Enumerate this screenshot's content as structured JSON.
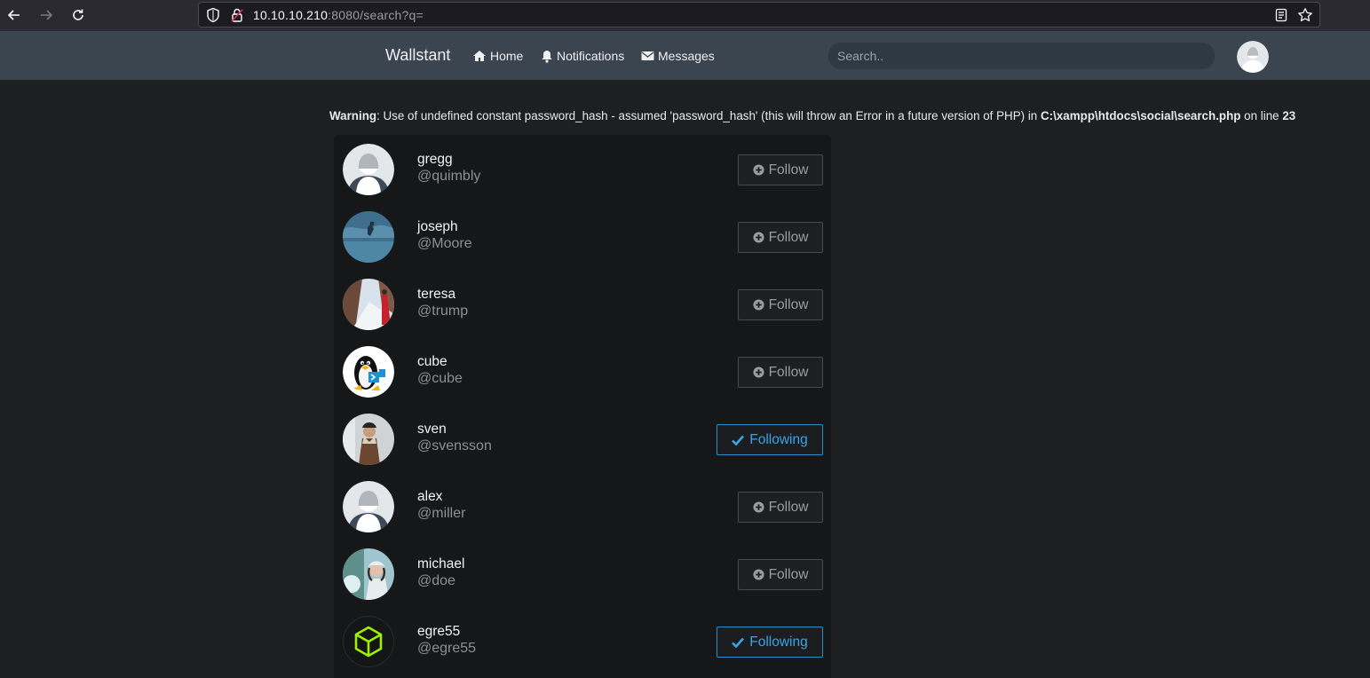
{
  "browser": {
    "url_host": "10.10.10.210",
    "url_rest": ":8080/search?q="
  },
  "navbar": {
    "brand": "Wallstant",
    "home": "Home",
    "notifications": "Notifications",
    "messages": "Messages",
    "search_placeholder": "Search.."
  },
  "warning": {
    "label": "Warning",
    "message": ": Use of undefined constant password_hash - assumed 'password_hash' (this will throw an Error in a future version of PHP) in ",
    "file": "C:\\xampp\\htdocs\\social\\search.php",
    "on_line": " on line ",
    "line": "23"
  },
  "colors": {
    "follow_text": "#9b9c9e",
    "following_accent": "#39a6e4",
    "navbar_bg": "#3a4550",
    "page_bg": "#1e1f21"
  },
  "users": [
    {
      "name": "gregg",
      "handle": "@quimbly",
      "button": "Follow",
      "following": false,
      "avatar": "default-avatar"
    },
    {
      "name": "joseph",
      "handle": "@Moore",
      "button": "Follow",
      "following": false,
      "avatar": "photo-blue-water"
    },
    {
      "name": "teresa",
      "handle": "@trump",
      "button": "Follow",
      "following": false,
      "avatar": "photo-snow-road"
    },
    {
      "name": "cube",
      "handle": "@cube",
      "button": "Follow",
      "following": false,
      "avatar": "tux-penguin"
    },
    {
      "name": "sven",
      "handle": "@svensson",
      "button": "Following",
      "following": true,
      "avatar": "photo-winter-man"
    },
    {
      "name": "alex",
      "handle": "@miller",
      "button": "Follow",
      "following": false,
      "avatar": "default-avatar"
    },
    {
      "name": "michael",
      "handle": "@doe",
      "button": "Follow",
      "following": false,
      "avatar": "photo-winter-woman"
    },
    {
      "name": "egre55",
      "handle": "@egre55",
      "button": "Following",
      "following": true,
      "avatar": "green-cube"
    }
  ]
}
